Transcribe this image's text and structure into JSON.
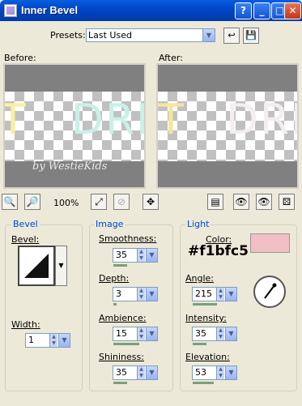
{
  "window": {
    "title": "Inner Bevel",
    "help": "?",
    "minimize": "_",
    "maximize": "□",
    "close": "✕"
  },
  "presets": {
    "label": "Presets:",
    "value": "Last Used"
  },
  "preview": {
    "before_label": "Before:",
    "after_label": "After:",
    "watermark": "by WestieKids",
    "zoom": "100%"
  },
  "bevel": {
    "group_title": "Bevel",
    "bevel_label": "Bevel:",
    "width_label": "Width:",
    "width_value": "1"
  },
  "image": {
    "group_title": "Image",
    "smoothness_label": "Smoothness:",
    "smoothness_value": "35",
    "depth_label": "Depth:",
    "depth_value": "3",
    "ambience_label": "Ambience:",
    "ambience_value": "15",
    "shininess_label": "Shininess:",
    "shininess_value": "35"
  },
  "light": {
    "group_title": "Light",
    "color_label": "Color:",
    "color_hex": "#f1bfc5",
    "angle_label": "Angle:",
    "angle_value": "215",
    "intensity_label": "Intensity:",
    "intensity_value": "35",
    "elevation_label": "Elevation:",
    "elevation_value": "53"
  },
  "icons": [
    "help-icon",
    "minimize-icon",
    "maximize-icon",
    "close-icon",
    "reset-icon",
    "save-preset-icon",
    "zoom-out-icon",
    "zoom-in-icon",
    "zoom-to-fit-icon",
    "lock-icon",
    "pan-icon",
    "preview-toggle-icon",
    "eye-icon",
    "eye-icon",
    "randomize-icon"
  ]
}
